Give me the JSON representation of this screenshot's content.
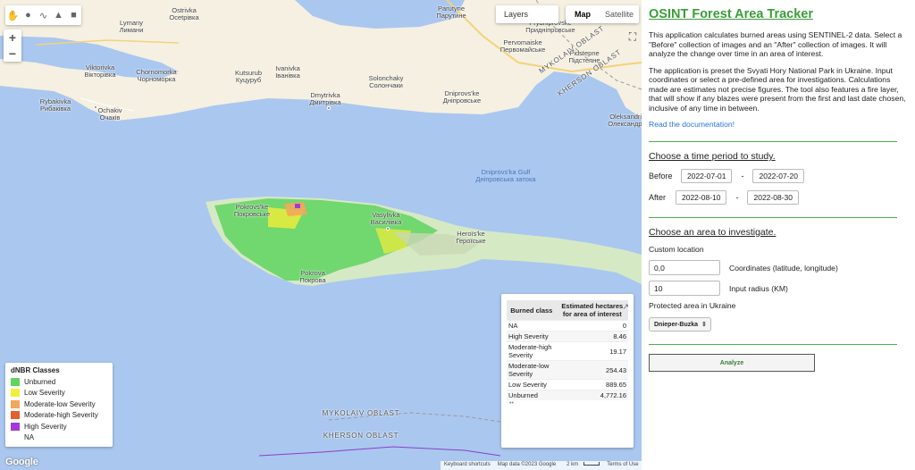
{
  "toolbar": {
    "tools": [
      {
        "icon": "hand-icon",
        "glyph": "✋"
      },
      {
        "icon": "marker-icon",
        "glyph": "●"
      },
      {
        "icon": "polyline-icon",
        "glyph": "∿"
      },
      {
        "icon": "polygon-icon",
        "glyph": "▲"
      },
      {
        "icon": "rectangle-icon",
        "glyph": "■"
      }
    ]
  },
  "zoom": {
    "in": "+",
    "out": "−"
  },
  "map_controls": {
    "layers": "Layers",
    "map": "Map",
    "satellite": "Satellite",
    "fullscreen_glyph": "⛶"
  },
  "places": [
    {
      "name": "Ostrivka\nOcetpiвка",
      "cls": ""
    },
    {
      "name": "Lymany\nЛимани",
      "cls": ""
    },
    {
      "name": "Viktorivka\nВікторівка",
      "cls": ""
    },
    {
      "name": "Chornomorka\nЧорноморка",
      "cls": ""
    },
    {
      "name": "Kutsurub\nКуцуруб",
      "cls": ""
    },
    {
      "name": "Ivanivka\nІванівка",
      "cls": ""
    },
    {
      "name": "Solonchaky\nСолончаки",
      "cls": ""
    },
    {
      "name": "Rybakivka\nРибаківка",
      "cls": ""
    },
    {
      "name": "Ochakiv\nОчаків",
      "cls": ""
    },
    {
      "name": "Dmytrivka\nДмитрівка",
      "cls": ""
    },
    {
      "name": "Dniprovs'ke\nДніпровське",
      "cls": ""
    },
    {
      "name": "Parutyne\nПарутине",
      "cls": ""
    },
    {
      "name": "Pervomaiske\nПервомайське",
      "cls": ""
    },
    {
      "name": "Prydniprovske\nПридніпровське",
      "cls": ""
    },
    {
      "name": "Pidstepne\nПідстепне",
      "cls": ""
    },
    {
      "name": "Dniprovs'ka Gulf\nДніпровська затока",
      "cls": "water"
    },
    {
      "name": "Pokrovs'ke\nПокровське",
      "cls": ""
    },
    {
      "name": "Vasylivka\nВасилівка",
      "cls": ""
    },
    {
      "name": "Heroïs'ke\nГероїське",
      "cls": ""
    },
    {
      "name": "Pokrova\nПокрова",
      "cls": ""
    },
    {
      "name": "MYKOLAIV OBLAST",
      "cls": "region"
    },
    {
      "name": "KHERSON OBLAST",
      "cls": "region"
    },
    {
      "name": "MYKOLAIV OBLAST",
      "cls": "region"
    },
    {
      "name": "KHERSON OBLAST",
      "cls": "region"
    },
    {
      "name": "Oleksandrivka\nОлександрівка",
      "cls": ""
    }
  ],
  "legend": {
    "title": "dNBR Classes",
    "items": [
      {
        "label": "Unburned",
        "color": "#5fd45f"
      },
      {
        "label": "Low Severity",
        "color": "#f2ee3a"
      },
      {
        "label": "Moderate-low Severity",
        "color": "#f4a75a"
      },
      {
        "label": "Moderate-high Severity",
        "color": "#e4602c"
      },
      {
        "label": "High Severity",
        "color": "#a13ad8"
      },
      {
        "label": "NA",
        "color": "#ffffff"
      }
    ]
  },
  "results_table": {
    "col1": "Burned class",
    "col2": "Estimated hectares for area of interest",
    "rows": [
      {
        "cls": "NA",
        "val": "0"
      },
      {
        "cls": "High Severity",
        "val": "8.46"
      },
      {
        "cls": "Moderate-high Severity",
        "val": "19.17"
      },
      {
        "cls": "Moderate-low Severity",
        "val": "254.43"
      },
      {
        "cls": "Low Severity",
        "val": "889.65"
      },
      {
        "cls": "Unburned",
        "val": "4,772.16"
      }
    ],
    "more": "••"
  },
  "footer": {
    "google": "Google",
    "shortcuts": "Keyboard shortcuts",
    "mapdata": "Map data ©2023 Google",
    "scale": "2 km",
    "terms": "Terms of Use"
  },
  "panel": {
    "title": "OSINT Forest Area Tracker",
    "intro": "This application calculates burned areas using SENTINEL-2 data. Select a \"Before\" collection of images and an \"After\" collection of images. It will analyze the change over time in an area of interest.",
    "intro2": "The application is preset the Svyati Hory National Park in Ukraine. Input coordinates or select a pre-defined area for investigations. Calculations made are estimates not precise figures. The tool also features a fire layer, that will show if any blazes were present from the first and last date chosen, inclusive of any time in between.",
    "doc_link": "Read the documentation!",
    "time_heading": "Choose a time period to study.",
    "before_label": "Before",
    "before_start": "2022-07-01",
    "before_end": "2022-07-20",
    "after_label": "After",
    "after_start": "2022-08-10",
    "after_end": "2022-08-30",
    "dash": "-",
    "area_heading": "Choose an area to investigate.",
    "custom_label": "Custom location",
    "coords_value": "0,0",
    "coords_label": "Coordinates (latitude, longitude)",
    "radius_value": "10",
    "radius_label": "Input radius (KM)",
    "protected_label": "Protected area in Ukraine",
    "protected_value": "Dnieper-Buzka",
    "analyze": "Analyze"
  }
}
